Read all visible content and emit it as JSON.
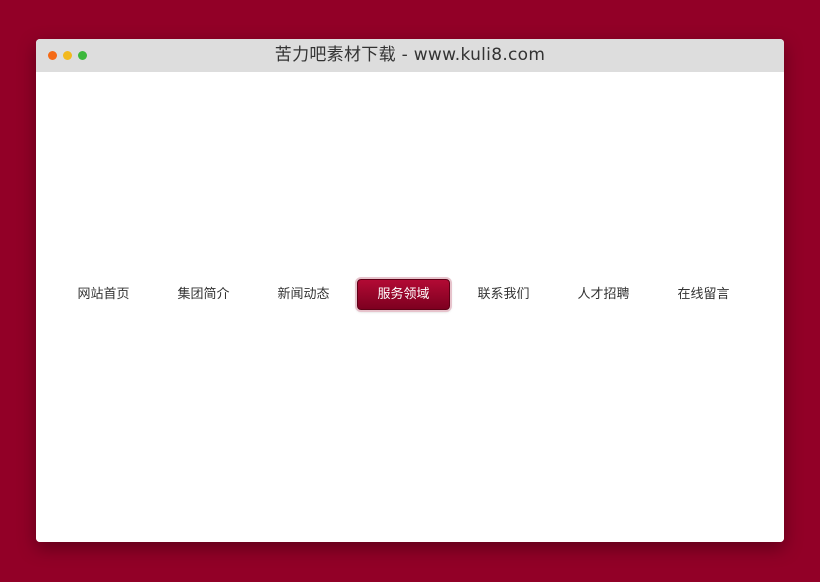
{
  "window": {
    "title": "苦力吧素材下载 - www.kuli8.com"
  },
  "nav": {
    "active_index": 3,
    "items": [
      {
        "label": "网站首页"
      },
      {
        "label": "集团简介"
      },
      {
        "label": "新闻动态"
      },
      {
        "label": "服务领域"
      },
      {
        "label": "联系我们"
      },
      {
        "label": "人才招聘"
      },
      {
        "label": "在线留言"
      }
    ]
  },
  "colors": {
    "page_background": "#920027",
    "active_item_background": "#9a0a2e",
    "titlebar": "#dddddd"
  }
}
